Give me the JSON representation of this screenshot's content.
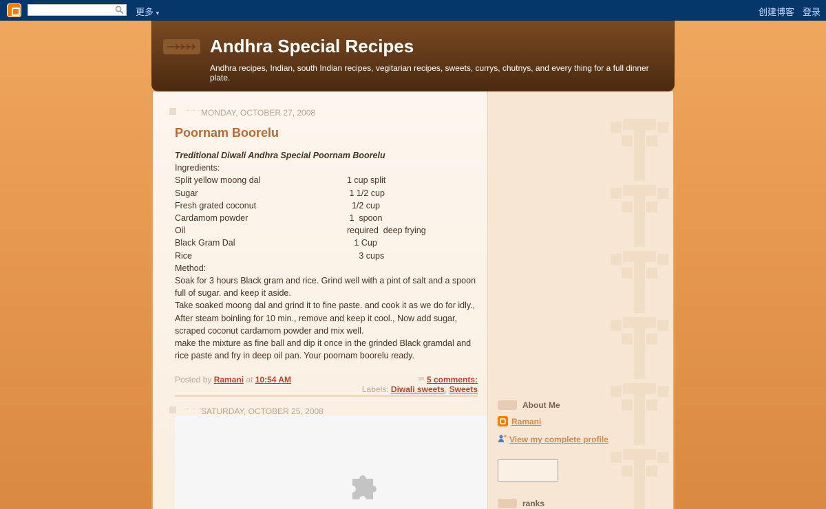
{
  "navbar": {
    "more_label": "更多",
    "create_blog_label": "创建博客",
    "login_label": "登录",
    "search_placeholder": ""
  },
  "header": {
    "title": "Andhra Special Recipes",
    "description": "Andhra recipes, Indian, south Indian recipes, vegitarian recipes, sweets, currys, chutnys, and every thing for a full dinner plate."
  },
  "posts": [
    {
      "date": "Monday, October 27, 2008",
      "title": "Poornam Boorelu",
      "lead": "Treditional Diwali Andhra Special Poornam Boorelu",
      "ingredients_label": "Ingredients:",
      "ingredients": [
        {
          "name": "Split yellow moong dal",
          "qty": "1 cup split"
        },
        {
          "name": "Sugar",
          "qty": " 1 1/2 cup"
        },
        {
          "name": "Fresh grated coconut",
          "qty": "  1/2 cup"
        },
        {
          "name": "Cardamom powder",
          "qty": " 1  spoon"
        },
        {
          "name": "Oil",
          "qty": "required  deep frying"
        },
        {
          "name": "Black Gram Dal",
          "qty": "   1 Cup"
        },
        {
          "name": "Rice",
          "qty": "     3 cups"
        }
      ],
      "method_label": "Method:",
      "method": [
        "Soak for 3 hours Black gram and rice. Grind well with a pint of salt and a spoon full of sugar. and keep it aside.",
        "Take soaked moong dal and grind it to fine paste. and cook it as we do for idly., After steam boinling for 10 min., remove and keep it cool., Now add sugar, scraped coconut cardamom powder and mix well.",
        "make the mixture as fine ball and dip it once in the grinded Black gramdal and rice paste and fry in deep oil pan.  Your poornam boorelu ready."
      ],
      "posted_by_label": "Posted by",
      "author": "Ramani",
      "at_label": "at",
      "time": "10:54 AM",
      "comments": "5 comments: ",
      "labels_label": "Labels:",
      "labels": [
        "Diwali sweets",
        "Sweets"
      ]
    },
    {
      "date": "Saturday, October 25, 2008"
    }
  ],
  "sidebar": {
    "about_title": "About Me",
    "profile_name": "Ramani",
    "view_profile": "View my complete profile",
    "ranks_title": "ranks"
  },
  "colors": {
    "navbar": "#05376b",
    "header": "#5a3515",
    "title_accent": "#b86a30",
    "link": "#b8442e"
  }
}
